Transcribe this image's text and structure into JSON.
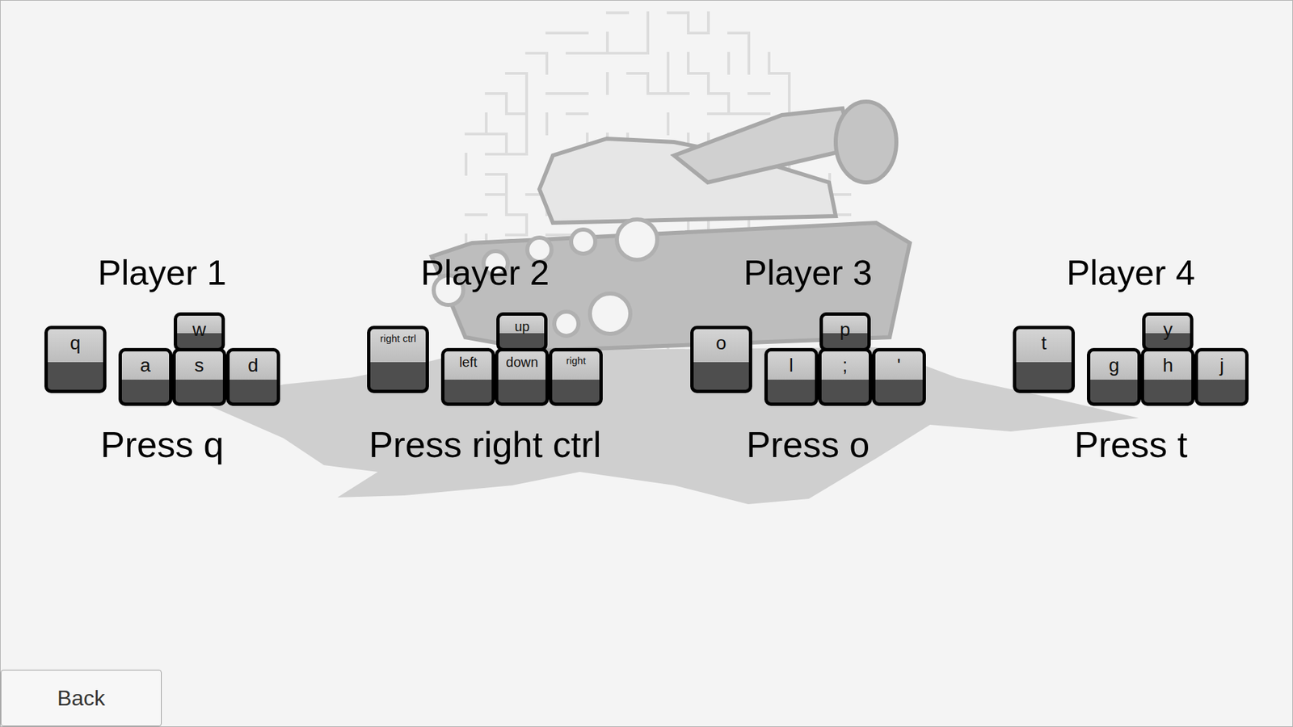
{
  "players": [
    {
      "name": "Player 1",
      "fire": "q",
      "keys": {
        "up": "w",
        "left": "a",
        "down": "s",
        "right": "d"
      },
      "prompt": "Press q"
    },
    {
      "name": "Player 2",
      "fire": "right ctrl",
      "keys": {
        "up": "up",
        "left": "left",
        "down": "down",
        "right": "right"
      },
      "prompt": "Press right ctrl"
    },
    {
      "name": "Player 3",
      "fire": "o",
      "keys": {
        "up": "p",
        "left": "l",
        "down": ";",
        "right": "'"
      },
      "prompt": "Press o"
    },
    {
      "name": "Player 4",
      "fire": "t",
      "keys": {
        "up": "y",
        "left": "g",
        "down": "h",
        "right": "j"
      },
      "prompt": "Press t"
    }
  ],
  "buttons": [
    "Back"
  ]
}
